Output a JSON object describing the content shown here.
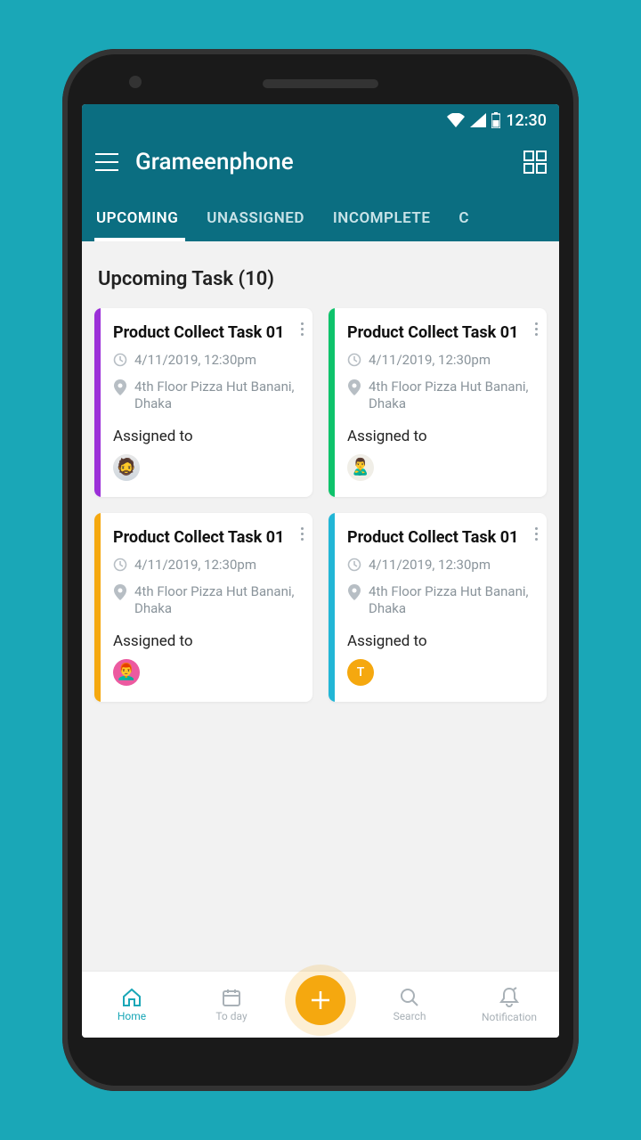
{
  "status": {
    "time": "12:30"
  },
  "header": {
    "title": "Grameenphone"
  },
  "tabs": [
    "UPCOMING",
    "UNASSIGNED",
    "INCOMPLETE",
    "C"
  ],
  "section_title": "Upcoming Task (10)",
  "cards": [
    {
      "title": "Product Collect Task 01",
      "datetime": "4/11/2019, 12:30pm",
      "location": "4th Floor Pizza Hut Banani, Dhaka",
      "assigned_label": "Assigned to",
      "stripe": "purple",
      "avatar": "person1"
    },
    {
      "title": "Product Collect Task 01",
      "datetime": "4/11/2019, 12:30pm",
      "location": "4th Floor Pizza Hut Banani, Dhaka",
      "assigned_label": "Assigned to",
      "stripe": "green",
      "avatar": "person2"
    },
    {
      "title": "Product Collect Task 01",
      "datetime": "4/11/2019, 12:30pm",
      "location": "4th Floor Pizza Hut Banani, Dhaka",
      "assigned_label": "Assigned to",
      "stripe": "orange",
      "avatar": "person3"
    },
    {
      "title": "Product Collect Task 01",
      "datetime": "4/11/2019, 12:30pm",
      "location": "4th Floor Pizza Hut Banani, Dhaka",
      "assigned_label": "Assigned to",
      "stripe": "blue",
      "avatar": "letter",
      "avatar_letter": "T"
    }
  ],
  "nav": {
    "home": "Home",
    "today": "To day",
    "search": "Search",
    "notification": "Notification"
  }
}
